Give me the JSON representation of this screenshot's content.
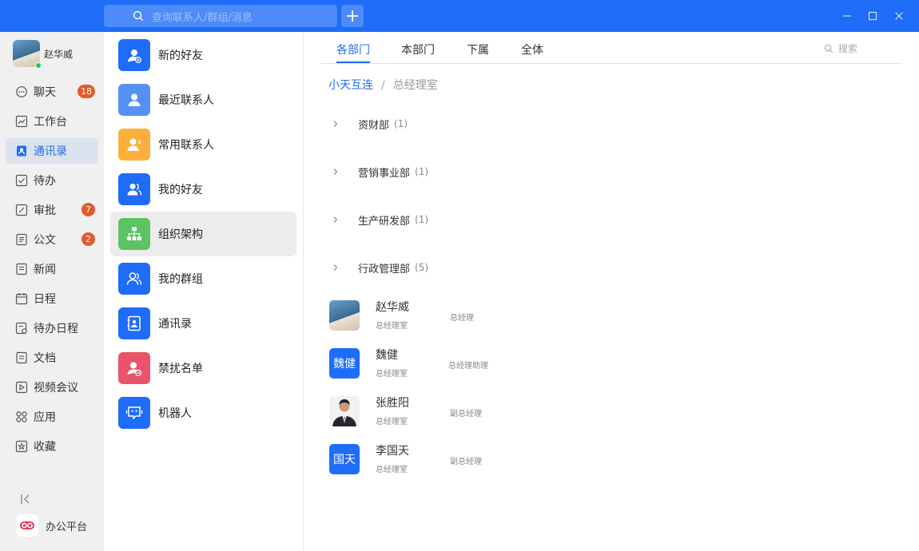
{
  "search": {
    "placeholder": "查询联系人/群组/消息"
  },
  "user": {
    "name": "赵华威"
  },
  "nav": [
    {
      "label": "聊天",
      "icon": "chat-icon",
      "badge": "18"
    },
    {
      "label": "工作台",
      "icon": "chart-icon",
      "badge": ""
    },
    {
      "label": "通讯录",
      "icon": "contacts-icon",
      "badge": "",
      "active": true
    },
    {
      "label": "待办",
      "icon": "checkbox-icon",
      "badge": ""
    },
    {
      "label": "审批",
      "icon": "edit-icon",
      "badge": "7"
    },
    {
      "label": "公文",
      "icon": "document-icon",
      "badge": "2"
    },
    {
      "label": "新闻",
      "icon": "news-icon",
      "badge": ""
    },
    {
      "label": "日程",
      "icon": "calendar-icon",
      "badge": ""
    },
    {
      "label": "待办日程",
      "icon": "todo-schedule-icon",
      "badge": ""
    },
    {
      "label": "文档",
      "icon": "file-icon",
      "badge": ""
    },
    {
      "label": "视频会议",
      "icon": "video-icon",
      "badge": ""
    },
    {
      "label": "应用",
      "icon": "apps-icon",
      "badge": ""
    },
    {
      "label": "收藏",
      "icon": "star-icon",
      "badge": ""
    }
  ],
  "platform": {
    "label": "办公平台"
  },
  "contacts_menu": [
    {
      "label": "新的好友",
      "icon": "add-friend-icon",
      "color": "#1e6cf7"
    },
    {
      "label": "最近联系人",
      "icon": "recent-contact-icon",
      "color": "#5591f5"
    },
    {
      "label": "常用联系人",
      "icon": "frequent-contact-icon",
      "color": "#fbb03b"
    },
    {
      "label": "我的好友",
      "icon": "friends-icon",
      "color": "#1e6cf7"
    },
    {
      "label": "组织架构",
      "icon": "org-chart-icon",
      "color": "#5cc462",
      "active": true
    },
    {
      "label": "我的群组",
      "icon": "groups-icon",
      "color": "#1e6cf7"
    },
    {
      "label": "通讯录",
      "icon": "address-book-icon",
      "color": "#1e6cf7"
    },
    {
      "label": "禁扰名单",
      "icon": "block-list-icon",
      "color": "#e9546b"
    },
    {
      "label": "机器人",
      "icon": "robot-icon",
      "color": "#1e6cf7"
    }
  ],
  "tabs": [
    "各部门",
    "本部门",
    "下属",
    "全体"
  ],
  "tab_search": "搜索",
  "breadcrumb": {
    "root": "小天互连",
    "separator": "/",
    "current": "总经理室"
  },
  "departments": [
    {
      "name": "资财部",
      "count": "(1)"
    },
    {
      "name": "营销事业部",
      "count": "(1)"
    },
    {
      "name": "生产研发部",
      "count": "(1)"
    },
    {
      "name": "行政管理部",
      "count": "(5)"
    }
  ],
  "people": [
    {
      "name": "赵华威",
      "dept": "总经理室",
      "title": "总经理",
      "avatar_text": ""
    },
    {
      "name": "魏健",
      "dept": "总经理室",
      "title": "总经理助理",
      "avatar_text": "魏健"
    },
    {
      "name": "张胜阳",
      "dept": "总经理室",
      "title": "副总经理",
      "avatar_text": ""
    },
    {
      "name": "李国天",
      "dept": "总经理室",
      "title": "副总经理",
      "avatar_text": "国天"
    }
  ]
}
